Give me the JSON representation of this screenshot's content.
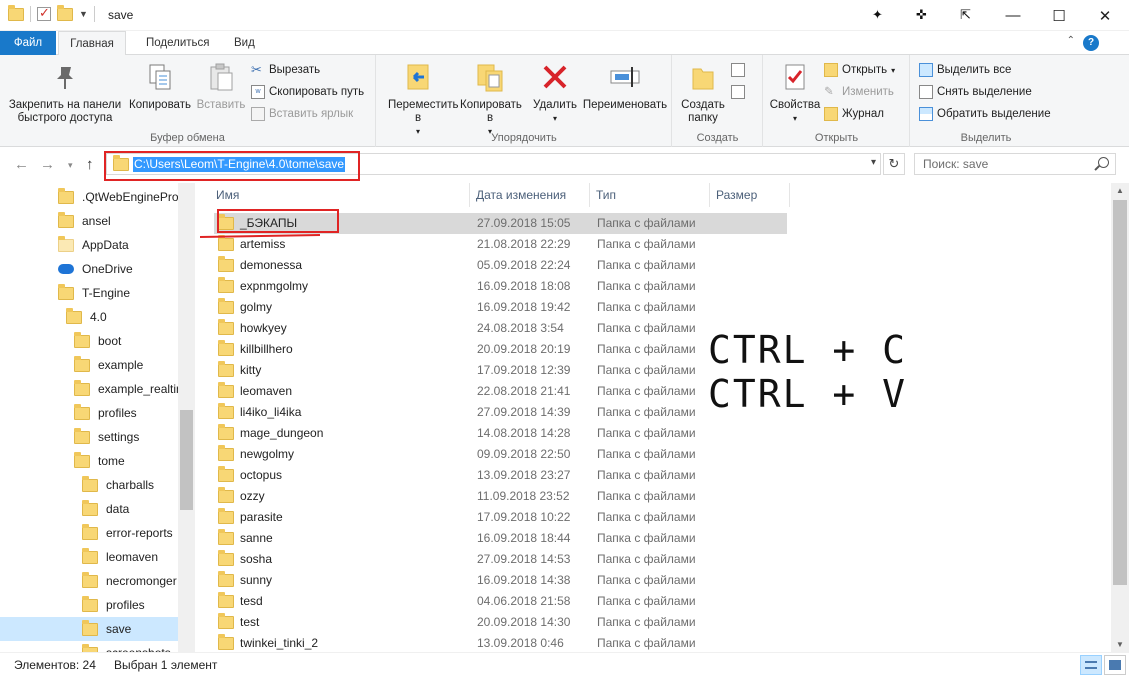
{
  "window": {
    "title": "save",
    "controls": {
      "minimize": "—",
      "maximize": "☐",
      "close": "✕"
    }
  },
  "ribbon_tabs": [
    {
      "label": "Файл"
    },
    {
      "label": "Главная"
    },
    {
      "label": "Поделиться"
    },
    {
      "label": "Вид"
    }
  ],
  "ribbon": {
    "clipboard": {
      "label": "Буфер обмена",
      "pin": "Закрепить на панели быстрого доступа",
      "copy": "Копировать",
      "paste": "Вставить",
      "cut": "Вырезать",
      "copy_path": "Скопировать путь",
      "paste_shortcut": "Вставить ярлык"
    },
    "organize": {
      "label": "Упорядочить",
      "move_to": "Переместить в",
      "copy_to": "Копировать в",
      "delete": "Удалить",
      "rename": "Переименовать"
    },
    "new": {
      "label": "Создать",
      "new_folder": "Создать папку"
    },
    "open": {
      "label": "Открыть",
      "properties": "Свойства",
      "open": "Открыть",
      "edit": "Изменить",
      "history": "Журнал"
    },
    "select": {
      "label": "Выделить",
      "select_all": "Выделить все",
      "select_none": "Снять выделение",
      "invert": "Обратить выделение"
    }
  },
  "address": {
    "path": "C:\\Users\\Leom\\T-Engine\\4.0\\tome\\save",
    "search_placeholder": "Поиск: save"
  },
  "nav_pane": [
    {
      "label": ".QtWebEngineProc",
      "indent": 0,
      "icon": "folder"
    },
    {
      "label": "ansel",
      "indent": 0,
      "icon": "folder"
    },
    {
      "label": "AppData",
      "indent": 0,
      "icon": "folder-light"
    },
    {
      "label": "OneDrive",
      "indent": 0,
      "icon": "cloud"
    },
    {
      "label": "T-Engine",
      "indent": 0,
      "icon": "folder"
    },
    {
      "label": "4.0",
      "indent": 1,
      "icon": "folder"
    },
    {
      "label": "boot",
      "indent": 2,
      "icon": "folder"
    },
    {
      "label": "example",
      "indent": 2,
      "icon": "folder"
    },
    {
      "label": "example_realtim",
      "indent": 2,
      "icon": "folder"
    },
    {
      "label": "profiles",
      "indent": 2,
      "icon": "folder"
    },
    {
      "label": "settings",
      "indent": 2,
      "icon": "folder"
    },
    {
      "label": "tome",
      "indent": 2,
      "icon": "folder"
    },
    {
      "label": "charballs",
      "indent": 3,
      "icon": "folder"
    },
    {
      "label": "data",
      "indent": 3,
      "icon": "folder"
    },
    {
      "label": "error-reports",
      "indent": 3,
      "icon": "folder"
    },
    {
      "label": "leomaven",
      "indent": 3,
      "icon": "folder"
    },
    {
      "label": "necromonger",
      "indent": 3,
      "icon": "folder"
    },
    {
      "label": "profiles",
      "indent": 3,
      "icon": "folder"
    },
    {
      "label": "save",
      "indent": 3,
      "icon": "folder",
      "selected": true
    },
    {
      "label": "screenshots",
      "indent": 3,
      "icon": "folder"
    }
  ],
  "columns": [
    "Имя",
    "Дата изменения",
    "Тип",
    "Размер"
  ],
  "files": [
    {
      "name": "_БЭКАПЫ",
      "date": "27.09.2018 15:05",
      "type": "Папка с файлами",
      "selected": true
    },
    {
      "name": "artemiss",
      "date": "21.08.2018 22:29",
      "type": "Папка с файлами"
    },
    {
      "name": "demonessa",
      "date": "05.09.2018 22:24",
      "type": "Папка с файлами"
    },
    {
      "name": "expnmgolmy",
      "date": "16.09.2018 18:08",
      "type": "Папка с файлами"
    },
    {
      "name": "golmy",
      "date": "16.09.2018 19:42",
      "type": "Папка с файлами"
    },
    {
      "name": "howkyey",
      "date": "24.08.2018 3:54",
      "type": "Папка с файлами"
    },
    {
      "name": "killbillhero",
      "date": "20.09.2018 20:19",
      "type": "Папка с файлами"
    },
    {
      "name": "kitty",
      "date": "17.09.2018 12:39",
      "type": "Папка с файлами"
    },
    {
      "name": "leomaven",
      "date": "22.08.2018 21:41",
      "type": "Папка с файлами"
    },
    {
      "name": "li4iko_li4ika",
      "date": "27.09.2018 14:39",
      "type": "Папка с файлами"
    },
    {
      "name": "mage_dungeon",
      "date": "14.08.2018 14:28",
      "type": "Папка с файлами"
    },
    {
      "name": "newgolmy",
      "date": "09.09.2018 22:50",
      "type": "Папка с файлами"
    },
    {
      "name": "octopus",
      "date": "13.09.2018 23:27",
      "type": "Папка с файлами"
    },
    {
      "name": "ozzy",
      "date": "11.09.2018 23:52",
      "type": "Папка с файлами"
    },
    {
      "name": "parasite",
      "date": "17.09.2018 10:22",
      "type": "Папка с файлами"
    },
    {
      "name": "sanne",
      "date": "16.09.2018 18:44",
      "type": "Папка с файлами"
    },
    {
      "name": "sosha",
      "date": "27.09.2018 14:53",
      "type": "Папка с файлами"
    },
    {
      "name": "sunny",
      "date": "16.09.2018 14:38",
      "type": "Папка с файлами"
    },
    {
      "name": "tesd",
      "date": "04.06.2018 21:58",
      "type": "Папка с файлами"
    },
    {
      "name": "test",
      "date": "20.09.2018 14:30",
      "type": "Папка с файлами"
    },
    {
      "name": "twinkei_tinki_2",
      "date": "13.09.2018 0:46",
      "type": "Папка с файлами"
    }
  ],
  "annotation": {
    "line1": "CTRL + C",
    "line2": "CTRL + V"
  },
  "status": {
    "count": "Элементов: 24",
    "selection": "Выбран 1 элемент"
  },
  "colors": {
    "accent": "#1979ca",
    "selection": "#cce8ff",
    "highlight_box": "#e02424",
    "folder": "#f8d775"
  }
}
